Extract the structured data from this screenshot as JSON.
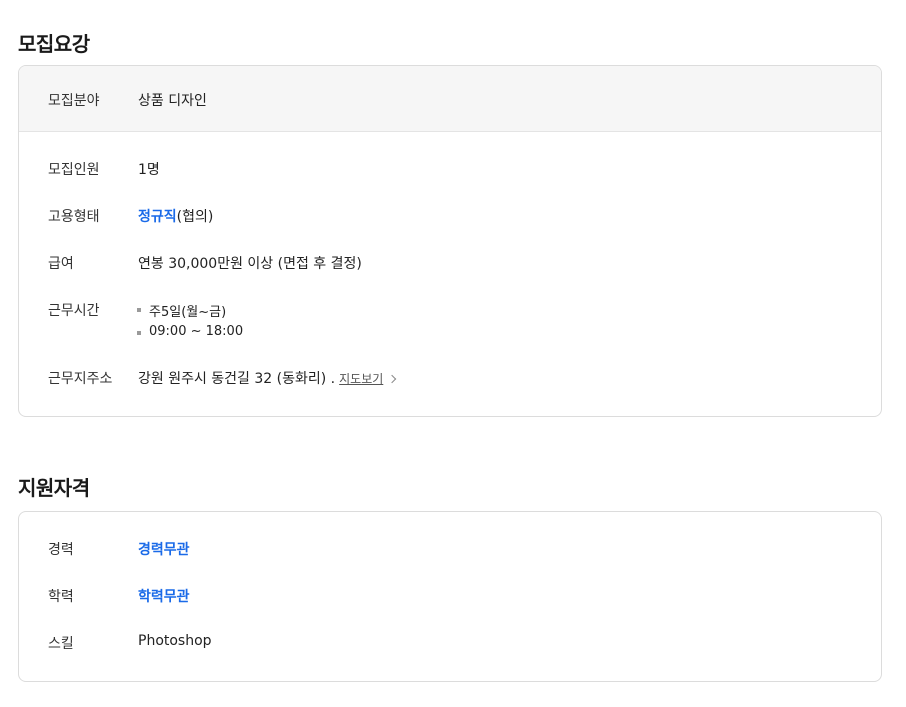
{
  "recruit": {
    "title": "모집요강",
    "field": {
      "label": "모집분야",
      "value": "상품 디자인"
    },
    "headcount": {
      "label": "모집인원",
      "value": "1명"
    },
    "employment": {
      "label": "고용형태",
      "value_link": "정규직",
      "value_suffix": "(협의)"
    },
    "salary": {
      "label": "급여",
      "value": "연봉 30,000만원 이상 (면접 후 결정)"
    },
    "hours": {
      "label": "근무시간",
      "items": [
        "주5일(월~금)",
        "09:00 ~ 18:00"
      ]
    },
    "address": {
      "label": "근무지주소",
      "value": "강원 원주시 동건길 32 (동화리) .",
      "map_link": "지도보기"
    }
  },
  "qualification": {
    "title": "지원자격",
    "career": {
      "label": "경력",
      "value": "경력무관"
    },
    "education": {
      "label": "학력",
      "value": "학력무관"
    },
    "skill": {
      "label": "스킬",
      "value": "Photoshop"
    }
  }
}
